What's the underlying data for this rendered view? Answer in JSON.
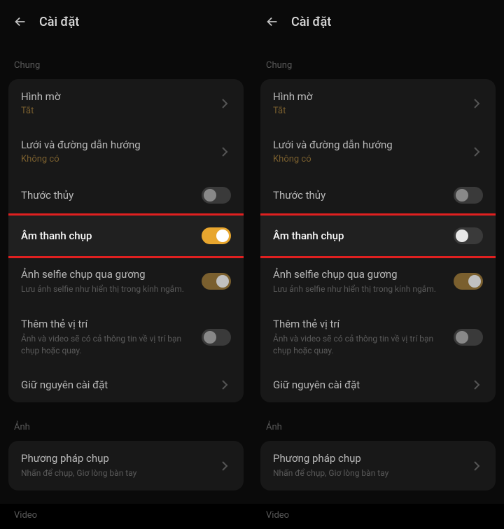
{
  "header": {
    "title": "Cài đặt"
  },
  "sections": {
    "general": "Chung",
    "photo": "Ảnh",
    "video": "Video"
  },
  "rows": {
    "watermark": {
      "title": "Hình mờ",
      "sub": "Tắt"
    },
    "grid": {
      "title": "Lưới và đường dẫn hướng",
      "sub": "Không có"
    },
    "level": {
      "title": "Thước thủy"
    },
    "shutter": {
      "title": "Âm thanh chụp"
    },
    "selfie": {
      "title": "Ảnh selfie chụp qua gương",
      "sub": "Lưu ảnh selfie như hiển thị trong kính ngắm."
    },
    "location": {
      "title": "Thêm thẻ vị trí",
      "sub": "Ảnh và video sẽ có cả thông tin về vị trí bạn chụp hoặc quay."
    },
    "keep": {
      "title": "Giữ nguyên cài đặt"
    },
    "method": {
      "title": "Phương pháp chụp",
      "sub": "Nhấn để chụp, Giơ lòng bàn tay"
    }
  }
}
